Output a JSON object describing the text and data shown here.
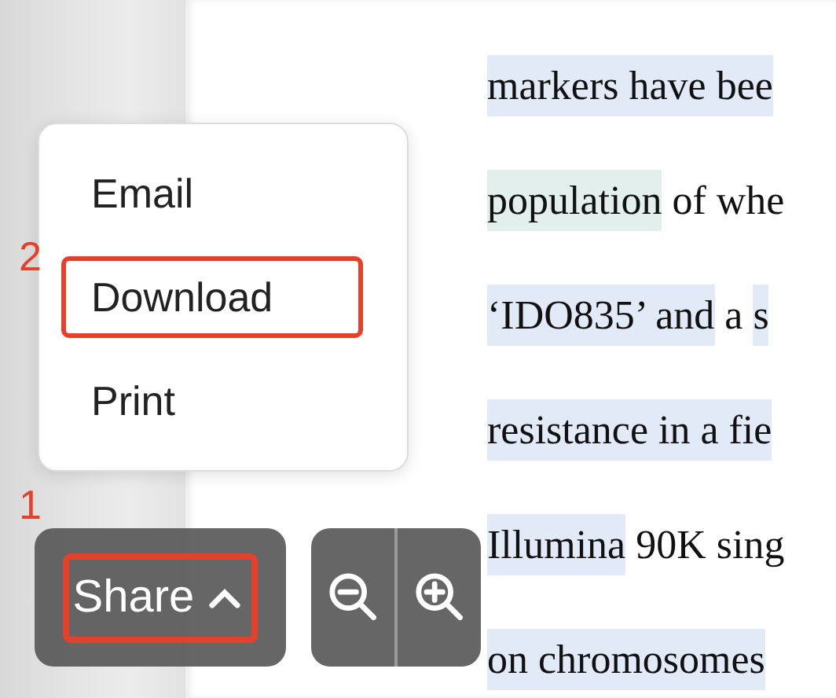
{
  "document": {
    "lines": [
      {
        "segments": [
          {
            "text": "markers have bee",
            "color": "#e1eaf6"
          }
        ]
      },
      {
        "segments": [
          {
            "text": "population",
            "color": "#e2efec"
          },
          {
            "text": " of whe"
          }
        ]
      },
      {
        "segments": [
          {
            "text": "‘IDO835’ and",
            "color": "#e1eaf6"
          },
          {
            "text": " a "
          },
          {
            "text": "s",
            "color": "#e1eaf6"
          }
        ]
      },
      {
        "segments": [
          {
            "text": "resistance in a fie",
            "color": "#e1eaf6"
          }
        ]
      },
      {
        "segments": [
          {
            "text": "Illumina",
            "color": "#e1eaf6"
          },
          {
            "text": " 90K sing"
          }
        ]
      },
      {
        "segments": [
          {
            "text": "on chromosomes",
            "color": "#e1eaf6"
          }
        ]
      }
    ]
  },
  "share_menu": {
    "items": [
      {
        "label": "Email",
        "selected": false
      },
      {
        "label": "Download",
        "selected": true,
        "callout": "2"
      },
      {
        "label": "Print",
        "selected": false
      }
    ]
  },
  "toolbar": {
    "share_button": {
      "label": "Share",
      "expanded": true,
      "selected": true,
      "callout": "1"
    }
  }
}
